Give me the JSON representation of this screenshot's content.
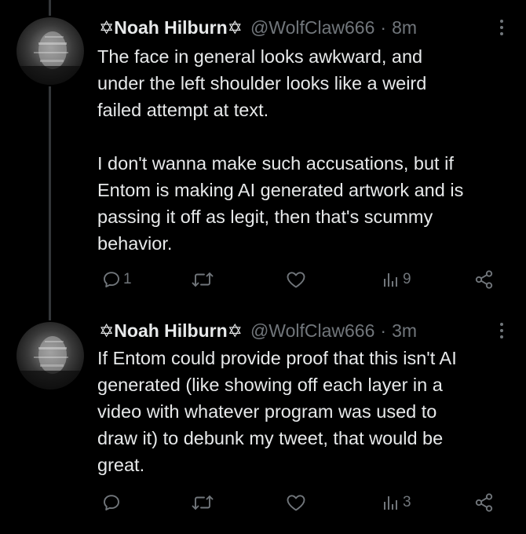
{
  "colors": {
    "background": "#000000",
    "text": "#e7e9ea",
    "secondary": "#71767b",
    "thread_line": "#333639"
  },
  "tweets": [
    {
      "name": "Noah Hilburn",
      "name_decoration": "✡",
      "handle": "@WolfClaw666",
      "separator": "·",
      "time": "8m",
      "text_lines": [
        "The face in general looks awkward, and",
        "under the left shoulder looks like a weird",
        "failed attempt at text.",
        "",
        "I don't wanna make such accusations, but if",
        "Entom is making AI generated artwork and is",
        "passing it off as legit, then that's scummy",
        "behavior."
      ],
      "reply_count": "1",
      "retweet_count": "",
      "like_count": "",
      "views_count": "9",
      "icons": [
        "reply-icon",
        "retweet-icon",
        "like-icon",
        "views-icon",
        "share-icon",
        "more-icon"
      ]
    },
    {
      "name": "Noah Hilburn",
      "name_decoration": "✡",
      "handle": "@WolfClaw666",
      "separator": "·",
      "time": "3m",
      "text_lines": [
        "If Entom could provide proof that this isn't AI",
        "generated (like showing off each layer in a",
        "video with whatever program was used to",
        "draw it) to debunk my tweet, that would be",
        "great."
      ],
      "reply_count": "",
      "retweet_count": "",
      "like_count": "",
      "views_count": "3",
      "icons": [
        "reply-icon",
        "retweet-icon",
        "like-icon",
        "views-icon",
        "share-icon",
        "more-icon"
      ]
    }
  ]
}
